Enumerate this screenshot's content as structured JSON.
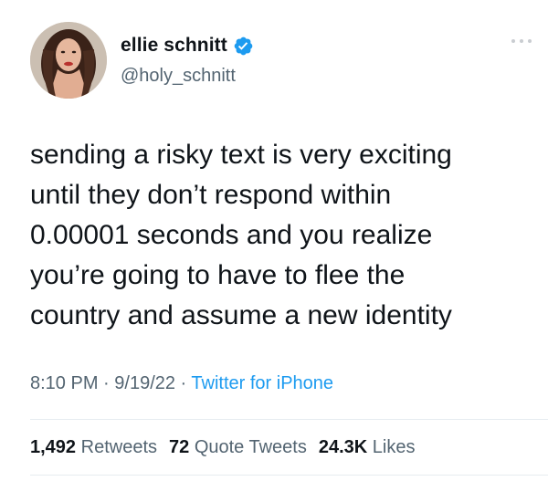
{
  "author": {
    "display_name": "ellie schnitt",
    "handle": "@holy_schnitt",
    "verified": true,
    "verified_color": "#1d9bf0"
  },
  "tweet": {
    "text_lines": [
      "sending a risky text is very exciting",
      "until they don’t respond within",
      "0.00001 seconds and you realize",
      "you’re going to have to flee the",
      "country and assume a new identity"
    ]
  },
  "meta": {
    "time": "8:10 PM",
    "separator1": " · ",
    "date": "9/19/22",
    "separator2": " · ",
    "source": "Twitter for iPhone"
  },
  "stats": {
    "retweets_count": "1,492",
    "retweets_label": "Retweets",
    "quotes_count": "72",
    "quotes_label": "Quote Tweets",
    "likes_count": "24.3K",
    "likes_label": "Likes"
  },
  "icons": {
    "more": "more-dots-icon",
    "verified": "verified-badge-icon"
  }
}
